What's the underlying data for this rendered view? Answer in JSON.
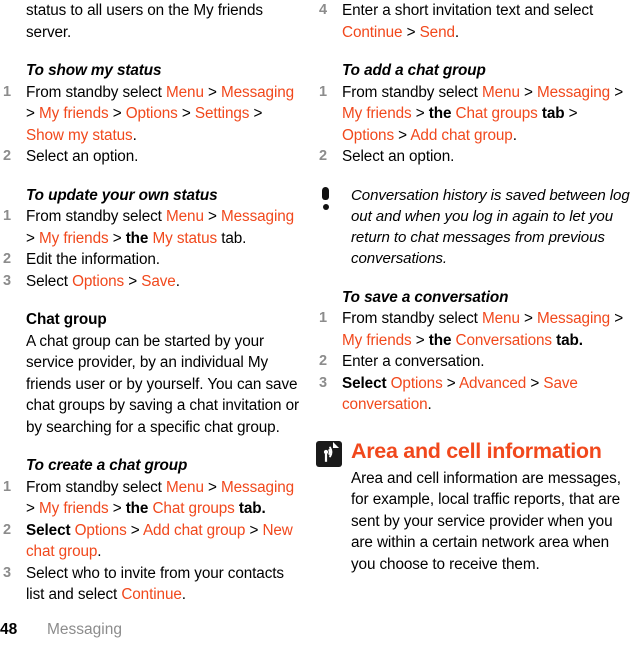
{
  "page": {
    "number": "48",
    "section": "Messaging",
    "accent_color": "#f1481c",
    "muted_color": "#8c8c8c"
  },
  "left_column": {
    "intro_para": "status to all users on the My friends server.",
    "proc_show_status": {
      "heading": "To show my status",
      "steps": [
        {
          "number": "1",
          "parts": [
            {
              "t": "From standby select ",
              "style": "plain"
            },
            {
              "t": "Menu",
              "style": "accent"
            },
            {
              "t": " > ",
              "style": "plain"
            },
            {
              "t": "Messaging",
              "style": "accent"
            },
            {
              "t": " > ",
              "style": "plain"
            },
            {
              "t": "My friends",
              "style": "accent"
            },
            {
              "t": " > ",
              "style": "plain"
            },
            {
              "t": "Options",
              "style": "accent"
            },
            {
              "t": " > ",
              "style": "plain"
            },
            {
              "t": "Settings",
              "style": "accent"
            },
            {
              "t": " > ",
              "style": "plain"
            },
            {
              "t": "Show my status",
              "style": "accent"
            },
            {
              "t": ".",
              "style": "plain"
            }
          ]
        },
        {
          "number": "2",
          "parts": [
            {
              "t": "Select an option.",
              "style": "plain"
            }
          ]
        }
      ]
    },
    "proc_update_status": {
      "heading": "To update your own status",
      "steps": [
        {
          "number": "1",
          "parts": [
            {
              "t": "From standby select ",
              "style": "plain"
            },
            {
              "t": "Menu",
              "style": "accent"
            },
            {
              "t": " > ",
              "style": "plain"
            },
            {
              "t": "Messaging",
              "style": "accent"
            },
            {
              "t": " > ",
              "style": "plain"
            },
            {
              "t": "My friends",
              "style": "accent"
            },
            {
              "t": " > ",
              "style": "plain"
            },
            {
              "t": "the ",
              "style": "bold"
            },
            {
              "t": "My status",
              "style": "accent"
            },
            {
              "t": " tab.",
              "style": "plain"
            }
          ]
        },
        {
          "number": "2",
          "parts": [
            {
              "t": "Edit the information.",
              "style": "plain"
            }
          ]
        },
        {
          "number": "3",
          "parts": [
            {
              "t": "Select ",
              "style": "plain"
            },
            {
              "t": "Options",
              "style": "accent"
            },
            {
              "t": " > ",
              "style": "plain"
            },
            {
              "t": "Save",
              "style": "accent"
            },
            {
              "t": ".",
              "style": "plain"
            }
          ]
        }
      ]
    },
    "chat_group_section": {
      "heading": "Chat group",
      "body": "A chat group can be started by your service provider, by an individual My friends user or by yourself. You can save chat groups by saving a chat invitation or by searching for a specific chat group."
    },
    "proc_create_chat_group": {
      "heading": "To create a chat group",
      "steps": [
        {
          "number": "1",
          "parts": [
            {
              "t": "From standby select ",
              "style": "plain"
            },
            {
              "t": "Menu",
              "style": "accent"
            },
            {
              "t": " > ",
              "style": "plain"
            },
            {
              "t": "Messaging",
              "style": "accent"
            },
            {
              "t": " > ",
              "style": "plain"
            },
            {
              "t": "My friends",
              "style": "accent"
            },
            {
              "t": " > ",
              "style": "plain"
            },
            {
              "t": "the ",
              "style": "bold"
            },
            {
              "t": "Chat groups",
              "style": "accent"
            },
            {
              "t": " tab.",
              "style": "bold"
            }
          ]
        },
        {
          "number": "2",
          "parts": [
            {
              "t": "Select ",
              "style": "bold"
            },
            {
              "t": "Options",
              "style": "accent"
            },
            {
              "t": " > ",
              "style": "plain"
            },
            {
              "t": "Add chat group",
              "style": "accent"
            },
            {
              "t": " > ",
              "style": "plain"
            },
            {
              "t": "New chat group",
              "style": "accent"
            },
            {
              "t": ".",
              "style": "plain"
            }
          ]
        },
        {
          "number": "3",
          "parts": [
            {
              "t": "Select who to invite from your contacts list and select ",
              "style": "plain"
            },
            {
              "t": "Continue",
              "style": "accent"
            },
            {
              "t": ".",
              "style": "plain"
            }
          ]
        }
      ]
    }
  },
  "right_column": {
    "step_four": {
      "number": "4",
      "parts": [
        {
          "t": "Enter a short invitation text and select ",
          "style": "plain"
        },
        {
          "t": "Continue",
          "style": "accent"
        },
        {
          "t": " > ",
          "style": "plain"
        },
        {
          "t": "Send",
          "style": "accent"
        },
        {
          "t": ".",
          "style": "plain"
        }
      ]
    },
    "proc_add_chat_group": {
      "heading": "To add a chat group",
      "steps": [
        {
          "number": "1",
          "parts": [
            {
              "t": "From standby select ",
              "style": "plain"
            },
            {
              "t": "Menu",
              "style": "accent"
            },
            {
              "t": " > ",
              "style": "plain"
            },
            {
              "t": "Messaging",
              "style": "accent"
            },
            {
              "t": " > ",
              "style": "plain"
            },
            {
              "t": "My friends",
              "style": "accent"
            },
            {
              "t": " > ",
              "style": "plain"
            },
            {
              "t": "the ",
              "style": "bold"
            },
            {
              "t": "Chat groups",
              "style": "accent"
            },
            {
              "t": " tab",
              "style": "bold"
            },
            {
              "t": " > ",
              "style": "plain"
            },
            {
              "t": "Options",
              "style": "accent"
            },
            {
              "t": " > ",
              "style": "plain"
            },
            {
              "t": "Add chat group",
              "style": "accent"
            },
            {
              "t": ".",
              "style": "plain"
            }
          ]
        },
        {
          "number": "2",
          "parts": [
            {
              "t": "Select an option.",
              "style": "plain"
            }
          ]
        }
      ]
    },
    "note": {
      "icon": "exclamation-icon",
      "text": "Conversation history is saved between log out and when you log in again to let you return to chat messages from previous conversations."
    },
    "proc_save_conversation": {
      "heading": "To save a conversation",
      "steps": [
        {
          "number": "1",
          "parts": [
            {
              "t": "From standby select ",
              "style": "plain"
            },
            {
              "t": "Menu",
              "style": "accent"
            },
            {
              "t": " > ",
              "style": "plain"
            },
            {
              "t": "Messaging",
              "style": "accent"
            },
            {
              "t": " > ",
              "style": "plain"
            },
            {
              "t": "My friends",
              "style": "accent"
            },
            {
              "t": " > ",
              "style": "plain"
            },
            {
              "t": "the ",
              "style": "bold"
            },
            {
              "t": "Conversations",
              "style": "accent"
            },
            {
              "t": " tab.",
              "style": "bold"
            }
          ]
        },
        {
          "number": "2",
          "parts": [
            {
              "t": "Enter a conversation.",
              "style": "plain"
            }
          ]
        },
        {
          "number": "3",
          "parts": [
            {
              "t": "Select ",
              "style": "bold"
            },
            {
              "t": "Options",
              "style": "accent"
            },
            {
              "t": " > ",
              "style": "plain"
            },
            {
              "t": "Advanced",
              "style": "accent"
            },
            {
              "t": " > ",
              "style": "plain"
            },
            {
              "t": "Save conversation",
              "style": "accent"
            },
            {
              "t": ".",
              "style": "plain"
            }
          ]
        }
      ]
    },
    "chapter": {
      "icon": "cell-broadcast-icon",
      "title": "Area and cell information",
      "body": "Area and cell information are messages, for example, local traffic reports, that are sent by your service provider when you are within a certain network area when you choose to receive them."
    }
  }
}
